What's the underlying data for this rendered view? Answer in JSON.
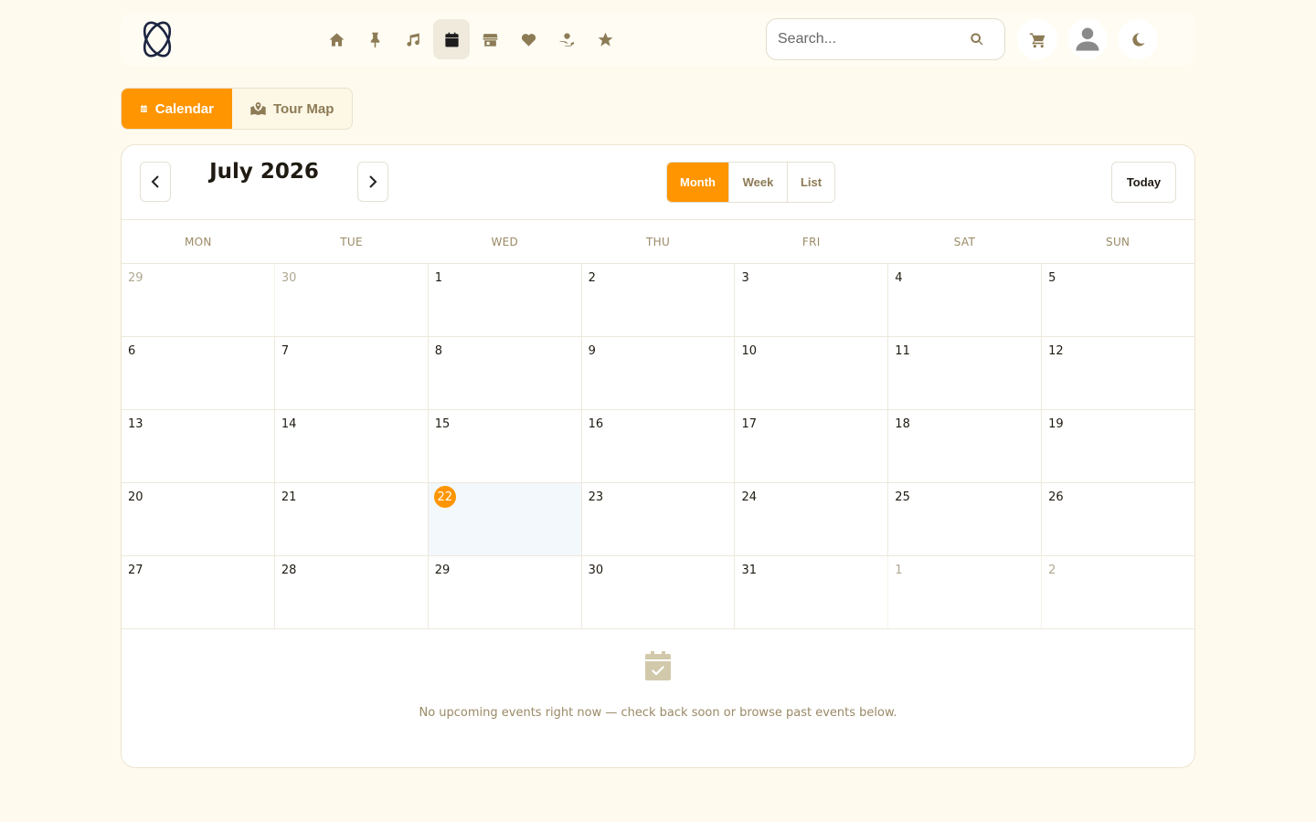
{
  "colors": {
    "accent": "#ff9500",
    "muted": "#8c7b55",
    "background": "#fefaee"
  },
  "nav": [
    {
      "name": "home-icon"
    },
    {
      "name": "pin-icon"
    },
    {
      "name": "music-icon"
    },
    {
      "name": "calendar-icon",
      "active": true
    },
    {
      "name": "store-icon"
    },
    {
      "name": "heart-icon"
    },
    {
      "name": "donate-icon"
    },
    {
      "name": "star-icon"
    }
  ],
  "search": {
    "placeholder": "Search..."
  },
  "toggle": {
    "calendar_label": "Calendar",
    "map_label": "Tour Map"
  },
  "calendar": {
    "title": "July 2026",
    "views": [
      "Month",
      "Week",
      "List"
    ],
    "active_view": "Month",
    "today_label": "Today",
    "weekdays": [
      "MON",
      "TUE",
      "WED",
      "THU",
      "FRI",
      "SAT",
      "SUN"
    ],
    "weeks": [
      [
        {
          "d": "29",
          "o": true
        },
        {
          "d": "30",
          "o": true
        },
        {
          "d": "1"
        },
        {
          "d": "2"
        },
        {
          "d": "3"
        },
        {
          "d": "4"
        },
        {
          "d": "5"
        }
      ],
      [
        {
          "d": "6"
        },
        {
          "d": "7"
        },
        {
          "d": "8"
        },
        {
          "d": "9"
        },
        {
          "d": "10"
        },
        {
          "d": "11"
        },
        {
          "d": "12"
        }
      ],
      [
        {
          "d": "13"
        },
        {
          "d": "14"
        },
        {
          "d": "15"
        },
        {
          "d": "16"
        },
        {
          "d": "17"
        },
        {
          "d": "18"
        },
        {
          "d": "19"
        }
      ],
      [
        {
          "d": "20"
        },
        {
          "d": "21"
        },
        {
          "d": "22",
          "t": true
        },
        {
          "d": "23"
        },
        {
          "d": "24"
        },
        {
          "d": "25"
        },
        {
          "d": "26"
        }
      ],
      [
        {
          "d": "27"
        },
        {
          "d": "28"
        },
        {
          "d": "29"
        },
        {
          "d": "30"
        },
        {
          "d": "31"
        },
        {
          "d": "1",
          "o": true
        },
        {
          "d": "2",
          "o": true
        }
      ]
    ],
    "empty_message": "No upcoming events right now — check back soon or browse past events below."
  }
}
